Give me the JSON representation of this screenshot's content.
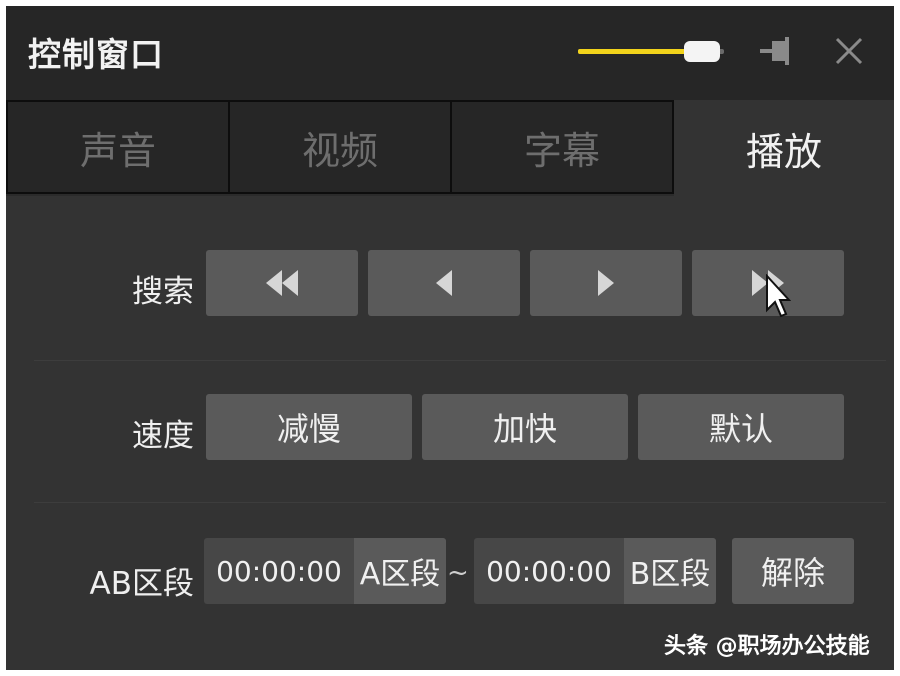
{
  "window": {
    "title": "控制窗口",
    "volume_level": 0.85
  },
  "tabs": [
    {
      "label": "声音",
      "active": false
    },
    {
      "label": "视频",
      "active": false
    },
    {
      "label": "字幕",
      "active": false
    },
    {
      "label": "播放",
      "active": true
    }
  ],
  "seek": {
    "label": "搜索",
    "buttons": [
      "fast-rewind-icon",
      "step-back-icon",
      "step-forward-icon",
      "fast-forward-icon"
    ]
  },
  "speed": {
    "label": "速度",
    "slower": "减慢",
    "faster": "加快",
    "default": "默认"
  },
  "ab_segment": {
    "label": "AB区段",
    "a_time": "00:00:00",
    "a_button": "A区段",
    "separator": "~",
    "b_time": "00:00:00",
    "b_button": "B区段",
    "clear": "解除"
  },
  "watermark": "头条 @职场办公技能",
  "colors": {
    "accent": "#f2d31b",
    "background": "#333333",
    "button": "#5a5a5a"
  }
}
